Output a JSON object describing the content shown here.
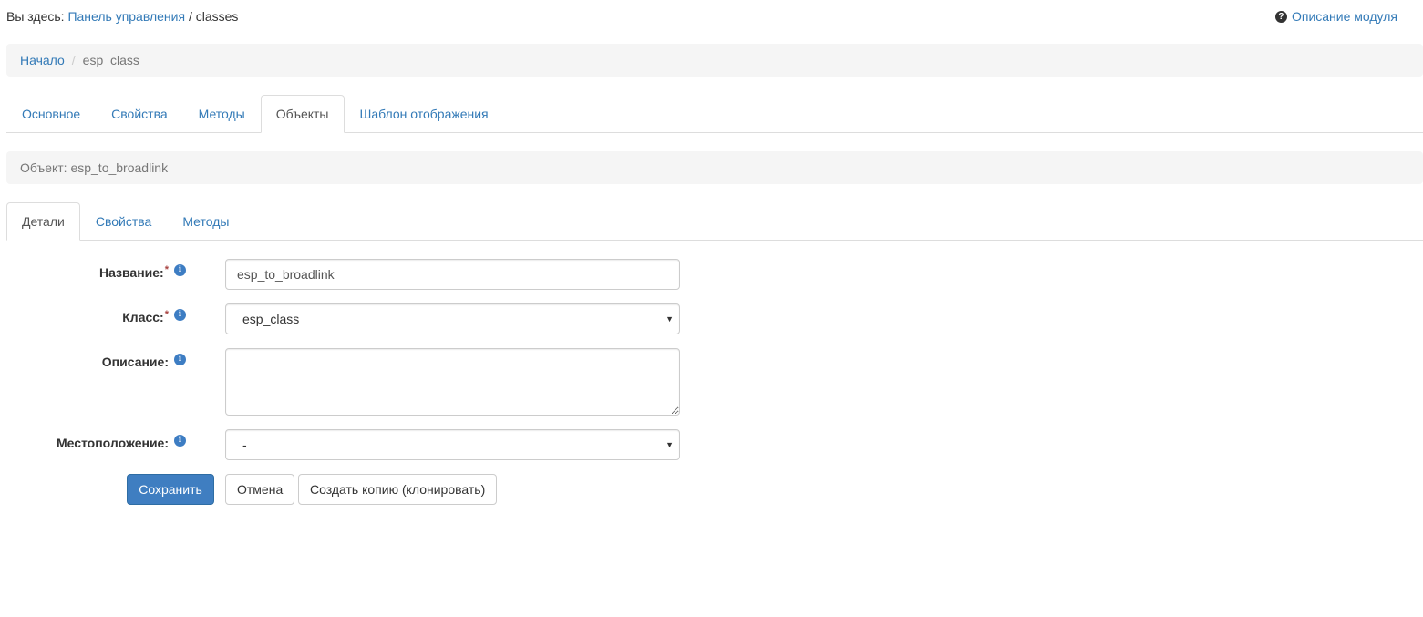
{
  "topbar": {
    "you_are_here": "Вы здесь:",
    "control_panel_link": "Панель управления",
    "separator": "/",
    "current": "classes",
    "module_help": "Описание модуля",
    "help_icon": "question-circle-icon"
  },
  "breadcrumb": {
    "home": "Начало",
    "separator": "/",
    "current": "esp_class"
  },
  "main_tabs": [
    {
      "label": "Основное",
      "active": false
    },
    {
      "label": "Свойства",
      "active": false
    },
    {
      "label": "Методы",
      "active": false
    },
    {
      "label": "Объекты",
      "active": true
    },
    {
      "label": "Шаблон отображения",
      "active": false
    }
  ],
  "object_bar": {
    "text": "Объект: esp_to_broadlink"
  },
  "sub_tabs": [
    {
      "label": "Детали",
      "active": true
    },
    {
      "label": "Свойства",
      "active": false
    },
    {
      "label": "Методы",
      "active": false
    }
  ],
  "form": {
    "name_label": "Название:",
    "name_value": "esp_to_broadlink",
    "class_label": "Класс:",
    "class_value": "esp_class",
    "description_label": "Описание:",
    "description_value": "",
    "location_label": "Местоположение:",
    "location_value": "-",
    "required_mark": "*",
    "info_icon": "info-circle-icon",
    "caret": "▼"
  },
  "buttons": {
    "save": "Сохранить",
    "cancel": "Отмена",
    "clone": "Создать копию (клонировать)"
  },
  "colors": {
    "link": "#337ab7",
    "primary": "#3f7ec1",
    "panel_bg": "#f5f5f5",
    "required": "#a94442"
  }
}
